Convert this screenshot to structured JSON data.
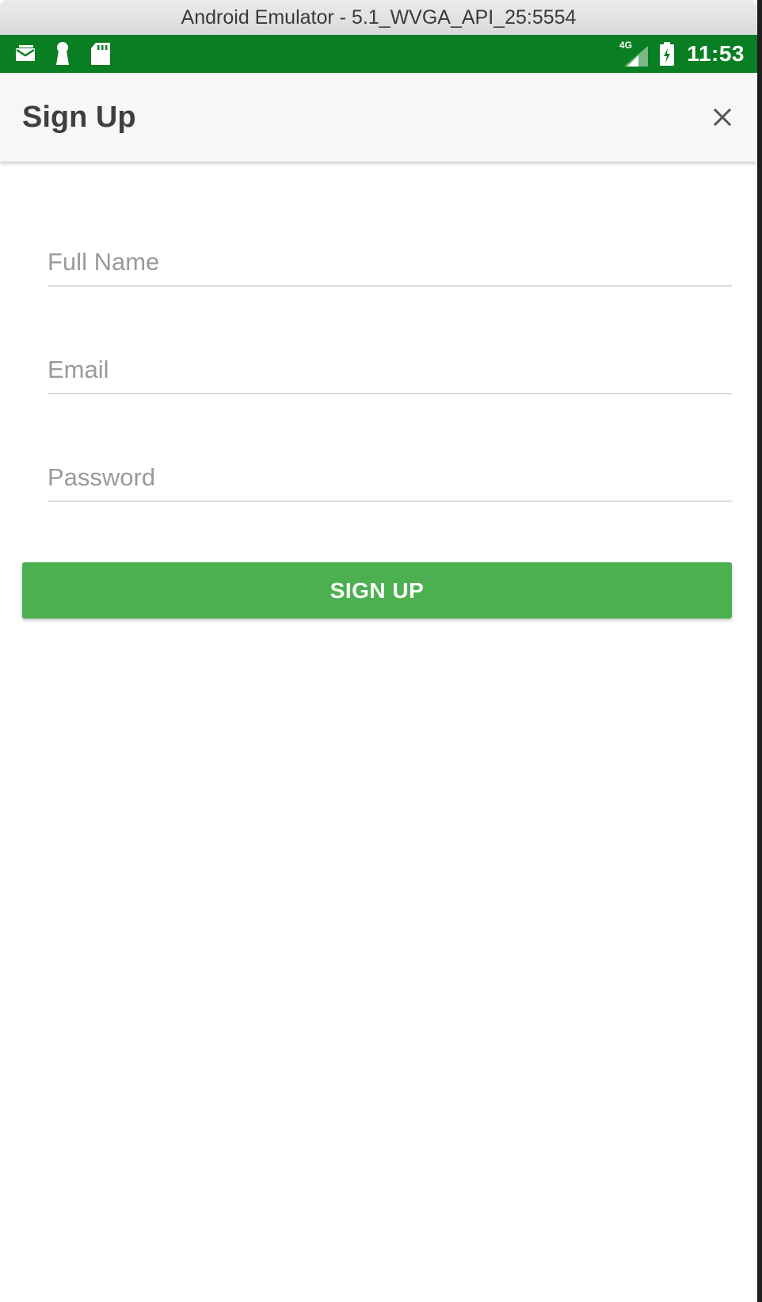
{
  "window": {
    "title": "Android Emulator - 5.1_WVGA_API_25:5554"
  },
  "status_bar": {
    "left_icons": [
      "mail-notification-icon",
      "keyhole-icon",
      "sd-card-icon"
    ],
    "network_label": "4G",
    "time": "11:53",
    "background_color": "#0a7e22"
  },
  "app_bar": {
    "title": "Sign Up",
    "close_icon": "close-icon"
  },
  "form": {
    "full_name": {
      "value": "",
      "placeholder": "Full Name"
    },
    "email": {
      "value": "",
      "placeholder": "Email"
    },
    "password": {
      "value": "",
      "placeholder": "Password"
    },
    "submit_label": "SIGN UP",
    "accent_color": "#4caf50"
  }
}
